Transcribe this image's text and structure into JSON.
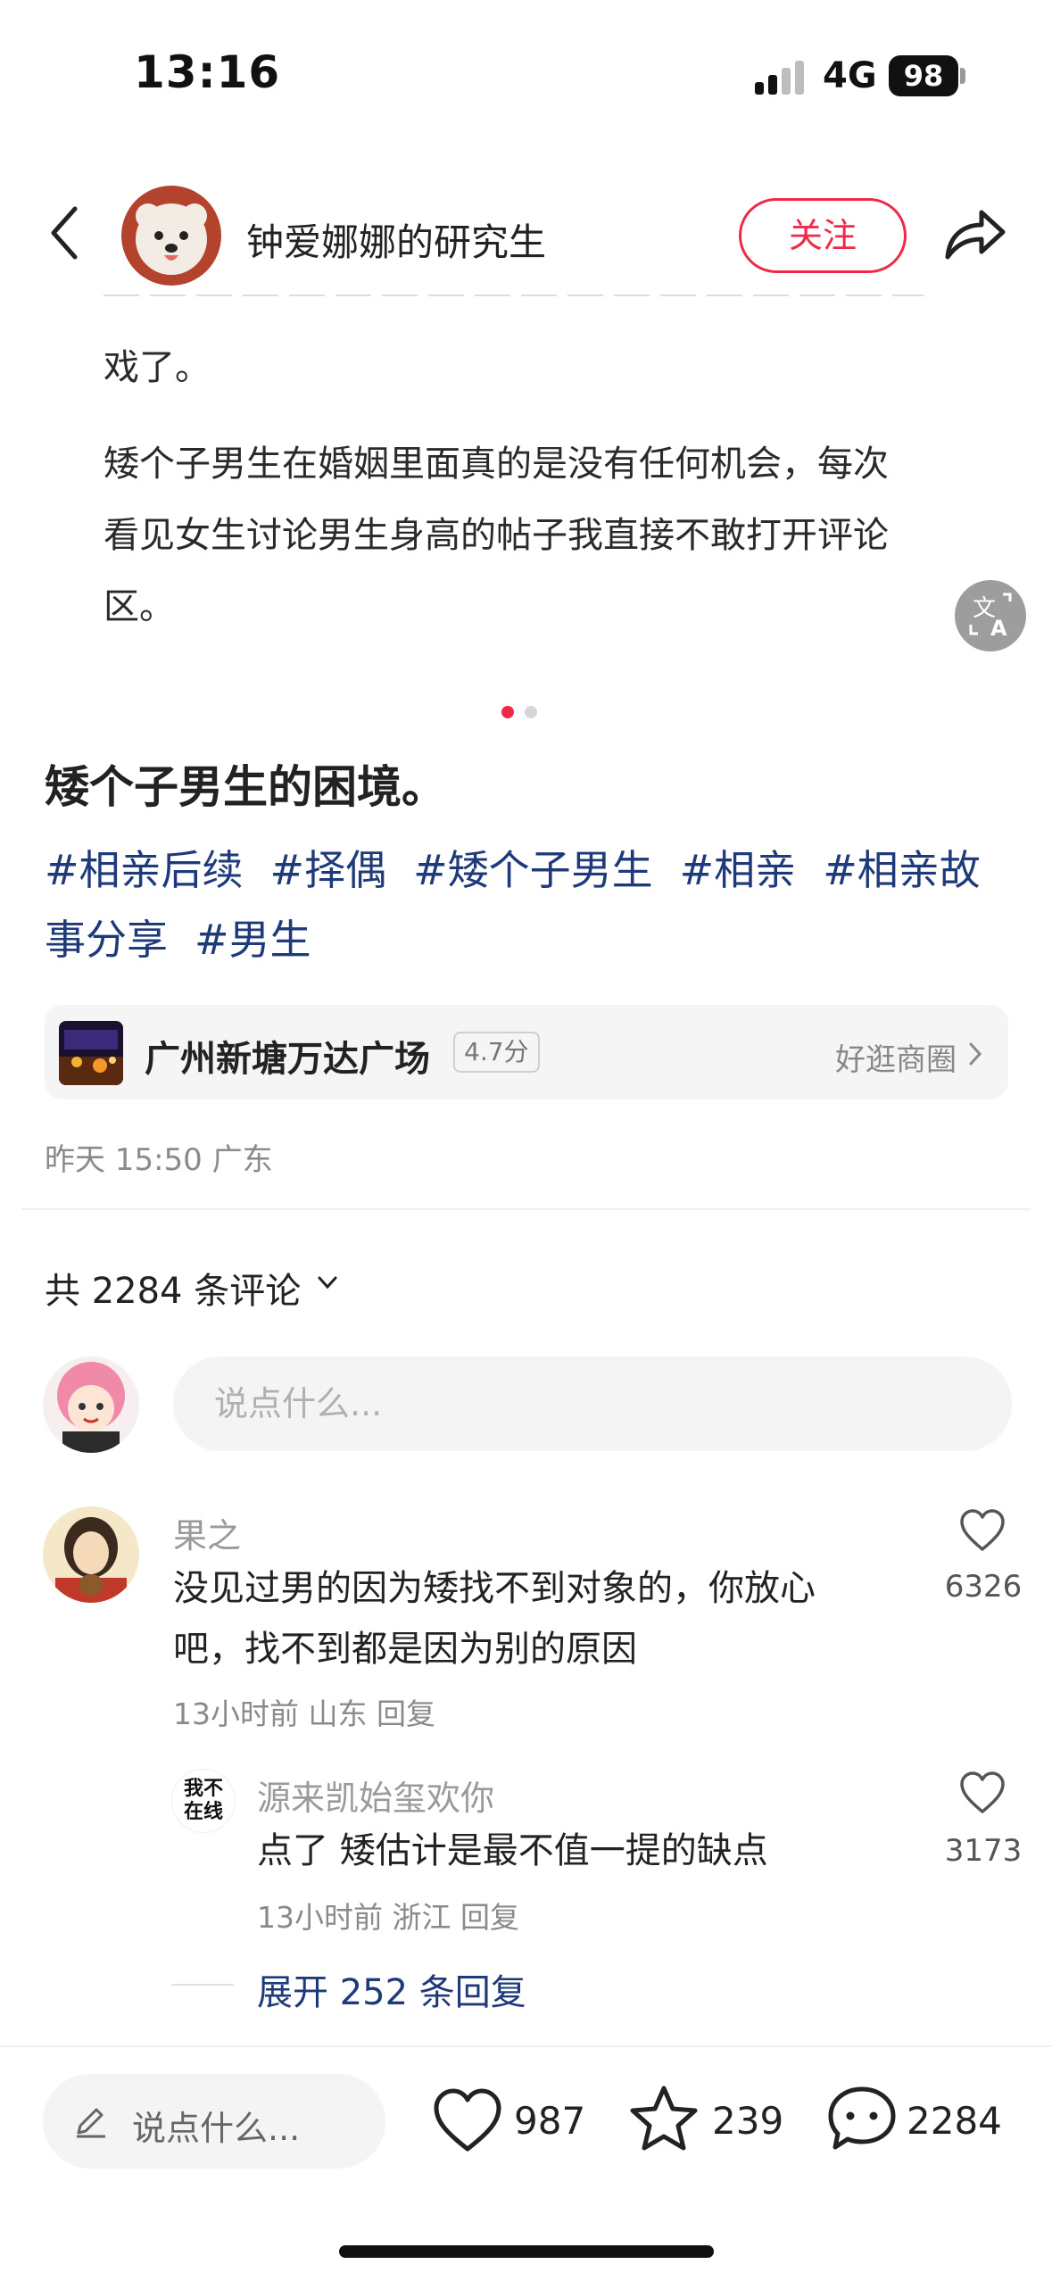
{
  "status_bar": {
    "time": "13:16",
    "network": "4G",
    "battery": "98"
  },
  "header": {
    "author_name": "钟爱娜娜的研究生",
    "follow_label": "关注"
  },
  "post": {
    "text_fragment": "戏了。",
    "paragraph": "矮个子男生在婚姻里面真的是没有任何机会，每次看见女生讨论男生身高的帖子我直接不敢打开评论区。",
    "paragraph_lines": [
      "矮个子男生在婚姻里面真的是没有任何机会，每次",
      "看见女生讨论男生身高的帖子我直接不敢打开评论",
      "区。"
    ],
    "translate_icon": "translate-icon",
    "title": "矮个子男生的困境。",
    "tags_line1": [
      "#相亲后续",
      "#择偶",
      "#矮个子男生",
      "#相亲",
      "#相亲故"
    ],
    "tags_line2": [
      "事分享",
      "#男生"
    ],
    "poi": {
      "name": "广州新塘万达广场",
      "score": "4.7分",
      "right_label": "好逛商圈"
    },
    "meta": "昨天 15:50 广东"
  },
  "comments_section": {
    "count_label": "共 2284 条评论",
    "input_placeholder": "说点什么..."
  },
  "comments": [
    {
      "name": "果之",
      "lines": [
        "没见过男的因为矮找不到对象的，你放心",
        "吧，找不到都是因为别的原因"
      ],
      "meta": "13小时前  山东  回复",
      "likes": "6326"
    }
  ],
  "reply": {
    "avatar_text_1": "我不",
    "avatar_text_2": "在线",
    "name": "源来凯始玺欢你",
    "text": "点了 矮估计是最不值一提的缺点",
    "meta": "13小时前  浙江  回复",
    "likes": "3173"
  },
  "expand_label": "展开 252 条回复",
  "bottom_bar": {
    "input_placeholder": "说点什么...",
    "likes": "987",
    "stars": "239",
    "comments": "2284"
  },
  "colors": {
    "accent_red": "#ee2a48",
    "tag_blue": "#1f3a7a"
  }
}
